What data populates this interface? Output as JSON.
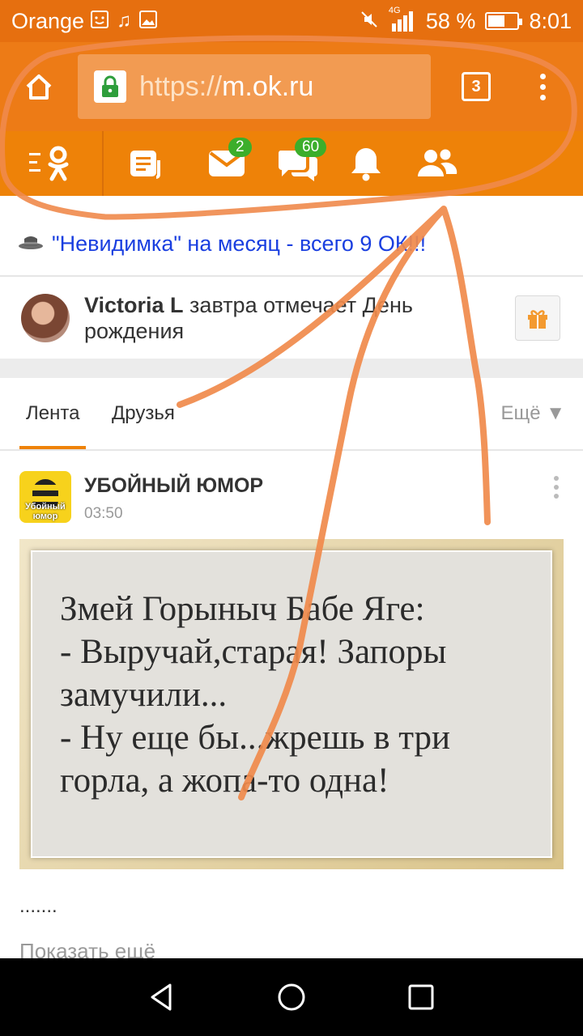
{
  "status_bar": {
    "carrier": "Orange",
    "battery_percent": "58 %",
    "battery_level": 0.58,
    "network": "4G",
    "time": "8:01",
    "icons": [
      "notification-icon",
      "music-icon",
      "image-icon",
      "mute-icon",
      "signal-icon",
      "battery-icon"
    ]
  },
  "browser": {
    "url_scheme": "https://",
    "url_host": "m.ok.ru",
    "tab_count": "3",
    "icons": [
      "home-icon",
      "lock-icon",
      "more-vert-icon"
    ]
  },
  "ok_nav": {
    "items": [
      {
        "name": "ok-menu",
        "icon": "ok-logo-icon",
        "badge": ""
      },
      {
        "name": "feed",
        "icon": "feed-icon",
        "badge": ""
      },
      {
        "name": "messages",
        "icon": "envelope-icon",
        "badge": "2"
      },
      {
        "name": "discussions",
        "icon": "chat-icon",
        "badge": "60"
      },
      {
        "name": "notifications",
        "icon": "bell-icon",
        "badge": ""
      },
      {
        "name": "friends",
        "icon": "friends-icon",
        "badge": ""
      }
    ]
  },
  "promo": {
    "text": "\"Невидимка\" на месяц - всего 9 ОК!!!"
  },
  "birthday": {
    "name": "Victoria L",
    "text": " завтра отмечает День рождения"
  },
  "feed_tabs": {
    "tabs": [
      "Лента",
      "Друзья"
    ],
    "active": "Лента",
    "more_label": "Ещё ▼"
  },
  "post": {
    "group_name": "УБОЙНЫЙ ЮМОР",
    "time": "03:50",
    "logo_text": "Убойный юмор",
    "image_lines": [
      "Змей Горыныч Бабе Яге:",
      "- Выручай,старая! Запоры",
      "замучили...",
      "- Ну еще бы...жрешь в три",
      "горла, а жопа-то одна!"
    ],
    "caption": ".......",
    "show_more": "Показать ещё"
  },
  "colors": {
    "status_bar": "#e66f0f",
    "browser_bar": "#ed7b16",
    "ok_orange": "#ee8208",
    "badge_green": "#3cae2b",
    "promo_link": "#1a3fe0",
    "annotation": "#f08a4b"
  }
}
